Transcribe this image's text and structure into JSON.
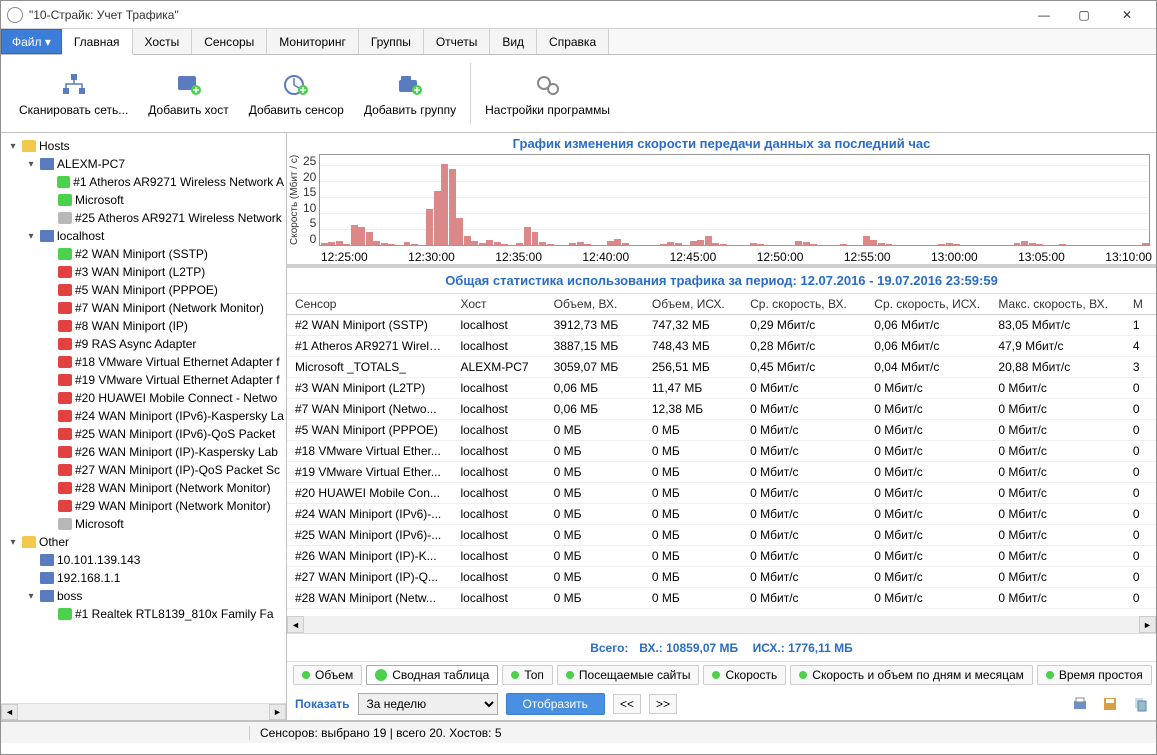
{
  "window": {
    "title": "\"10-Страйк: Учет Трафика\""
  },
  "menu": {
    "file": "Файл ▾",
    "tabs": [
      "Главная",
      "Хосты",
      "Сенсоры",
      "Мониторинг",
      "Группы",
      "Отчеты",
      "Вид",
      "Справка"
    ],
    "active": 0
  },
  "ribbon": {
    "scan": "Сканировать сеть...",
    "add_host": "Добавить хост",
    "add_sensor": "Добавить сенсор",
    "add_group": "Добавить группу",
    "settings": "Настройки программы"
  },
  "tree": [
    {
      "d": 0,
      "exp": "▾",
      "ic": "folder",
      "t": "Hosts"
    },
    {
      "d": 1,
      "exp": "▾",
      "ic": "pc",
      "t": "ALEXM-PC7"
    },
    {
      "d": 2,
      "exp": "",
      "ic": "green",
      "t": "#1 Atheros AR9271 Wireless Network A"
    },
    {
      "d": 2,
      "exp": "",
      "ic": "green",
      "t": "Microsoft"
    },
    {
      "d": 2,
      "exp": "",
      "ic": "gray",
      "t": "#25 Atheros AR9271 Wireless Network"
    },
    {
      "d": 1,
      "exp": "▾",
      "ic": "pc",
      "t": "localhost"
    },
    {
      "d": 2,
      "exp": "",
      "ic": "green",
      "t": "#2 WAN Miniport (SSTP)"
    },
    {
      "d": 2,
      "exp": "",
      "ic": "red",
      "t": "#3 WAN Miniport (L2TP)"
    },
    {
      "d": 2,
      "exp": "",
      "ic": "red",
      "t": "#5 WAN Miniport (PPPOE)"
    },
    {
      "d": 2,
      "exp": "",
      "ic": "red",
      "t": "#7 WAN Miniport (Network Monitor)"
    },
    {
      "d": 2,
      "exp": "",
      "ic": "red",
      "t": "#8 WAN Miniport (IP)"
    },
    {
      "d": 2,
      "exp": "",
      "ic": "red",
      "t": "#9 RAS Async Adapter"
    },
    {
      "d": 2,
      "exp": "",
      "ic": "red",
      "t": "#18 VMware Virtual Ethernet Adapter f"
    },
    {
      "d": 2,
      "exp": "",
      "ic": "red",
      "t": "#19 VMware Virtual Ethernet Adapter f"
    },
    {
      "d": 2,
      "exp": "",
      "ic": "red",
      "t": "#20 HUAWEI Mobile Connect - Netwo"
    },
    {
      "d": 2,
      "exp": "",
      "ic": "red",
      "t": "#24 WAN Miniport (IPv6)-Kaspersky La"
    },
    {
      "d": 2,
      "exp": "",
      "ic": "red",
      "t": "#25 WAN Miniport (IPv6)-QoS Packet"
    },
    {
      "d": 2,
      "exp": "",
      "ic": "red",
      "t": "#26 WAN Miniport (IP)-Kaspersky Lab"
    },
    {
      "d": 2,
      "exp": "",
      "ic": "red",
      "t": "#27 WAN Miniport (IP)-QoS Packet Sc"
    },
    {
      "d": 2,
      "exp": "",
      "ic": "red",
      "t": "#28 WAN Miniport (Network Monitor)"
    },
    {
      "d": 2,
      "exp": "",
      "ic": "red",
      "t": "#29 WAN Miniport (Network Monitor)"
    },
    {
      "d": 2,
      "exp": "",
      "ic": "gray",
      "t": "Microsoft"
    },
    {
      "d": 0,
      "exp": "▾",
      "ic": "folder",
      "t": "Other"
    },
    {
      "d": 1,
      "exp": "",
      "ic": "pc",
      "t": "10.101.139.143"
    },
    {
      "d": 1,
      "exp": "",
      "ic": "pc",
      "t": "192.168.1.1"
    },
    {
      "d": 1,
      "exp": "▾",
      "ic": "pc",
      "t": "boss"
    },
    {
      "d": 2,
      "exp": "",
      "ic": "green",
      "t": "#1 Realtek RTL8139_810x Family Fa"
    }
  ],
  "chart": {
    "title": "График изменения скорости передачи данных за последний час",
    "ylabel": "Скорость (Мбит / с)",
    "yticks": [
      "25",
      "20",
      "15",
      "10",
      "5",
      "0"
    ],
    "xticks": [
      "12:25:00",
      "12:30:00",
      "12:35:00",
      "12:40:00",
      "12:45:00",
      "12:50:00",
      "12:55:00",
      "13:00:00",
      "13:05:00",
      "13:10:00"
    ]
  },
  "chart_data": {
    "type": "line",
    "ylabel": "Скорость (Мбит / с)",
    "ylim": [
      0,
      25
    ],
    "x": [
      "12:25:00",
      "12:30:00",
      "12:35:00",
      "12:40:00",
      "12:45:00",
      "12:50:00",
      "12:55:00",
      "13:00:00",
      "13:05:00",
      "13:10:00"
    ],
    "values_approx_pct_of_max": [
      2,
      3,
      5,
      1,
      22,
      20,
      15,
      4,
      2,
      1,
      0,
      3,
      1,
      0,
      40,
      60,
      90,
      85,
      30,
      10,
      4,
      2,
      6,
      3,
      1,
      0,
      2,
      20,
      14,
      3,
      1,
      0,
      0,
      2,
      3,
      1,
      0,
      0,
      5,
      7,
      2,
      0,
      0,
      0,
      0,
      1,
      3,
      2,
      0,
      4,
      6,
      10,
      2,
      1,
      0,
      0,
      0,
      2,
      1,
      0,
      0,
      0,
      0,
      5,
      3,
      1,
      0,
      0,
      0,
      1,
      0,
      0,
      10,
      6,
      2,
      1,
      0,
      0,
      0,
      0,
      0,
      0,
      1,
      2,
      1,
      0,
      0,
      0,
      0,
      0,
      0,
      0,
      2,
      4,
      2,
      1,
      0,
      0,
      1,
      0,
      0,
      0,
      0,
      0,
      0,
      0,
      0,
      0,
      0,
      2
    ]
  },
  "stats": {
    "title": "Общая статистика использования трафика за период: 12.07.2016 - 19.07.2016 23:59:59",
    "cols": [
      "Сенсор",
      "Хост",
      "Объем, ВХ.",
      "Объем, ИСХ.",
      "Ср. скорость, ВХ.",
      "Ср. скорость, ИСХ.",
      "Макс. скорость, ВХ.",
      "М"
    ],
    "rows": [
      [
        "#2 WAN Miniport (SSTP)",
        "localhost",
        "3912,73 МБ",
        "747,32 МБ",
        "0,29 Мбит/с",
        "0,06 Мбит/с",
        "83,05 Мбит/с",
        "1"
      ],
      [
        "#1 Atheros AR9271 Wirele...",
        "localhost",
        "3887,15 МБ",
        "748,43 МБ",
        "0,28 Мбит/с",
        "0,06 Мбит/с",
        "47,9 Мбит/с",
        "4"
      ],
      [
        "Microsoft _TOTALS_",
        "ALEXM-PC7",
        "3059,07 МБ",
        "256,51 МБ",
        "0,45 Мбит/с",
        "0,04 Мбит/с",
        "20,88 Мбит/с",
        "3"
      ],
      [
        "#3 WAN Miniport (L2TP)",
        "localhost",
        "0,06 МБ",
        "11,47 МБ",
        "0 Мбит/с",
        "0 Мбит/с",
        "0 Мбит/с",
        "0"
      ],
      [
        "#7 WAN Miniport (Netwo...",
        "localhost",
        "0,06 МБ",
        "12,38 МБ",
        "0 Мбит/с",
        "0 Мбит/с",
        "0 Мбит/с",
        "0"
      ],
      [
        "#5 WAN Miniport (PPPOE)",
        "localhost",
        "0 МБ",
        "0 МБ",
        "0 Мбит/с",
        "0 Мбит/с",
        "0 Мбит/с",
        "0"
      ],
      [
        "#18 VMware Virtual Ether...",
        "localhost",
        "0 МБ",
        "0 МБ",
        "0 Мбит/с",
        "0 Мбит/с",
        "0 Мбит/с",
        "0"
      ],
      [
        "#19 VMware Virtual Ether...",
        "localhost",
        "0 МБ",
        "0 МБ",
        "0 Мбит/с",
        "0 Мбит/с",
        "0 Мбит/с",
        "0"
      ],
      [
        "#20 HUAWEI Mobile Con...",
        "localhost",
        "0 МБ",
        "0 МБ",
        "0 Мбит/с",
        "0 Мбит/с",
        "0 Мбит/с",
        "0"
      ],
      [
        "#24 WAN Miniport (IPv6)-...",
        "localhost",
        "0 МБ",
        "0 МБ",
        "0 Мбит/с",
        "0 Мбит/с",
        "0 Мбит/с",
        "0"
      ],
      [
        "#25 WAN Miniport (IPv6)-...",
        "localhost",
        "0 МБ",
        "0 МБ",
        "0 Мбит/с",
        "0 Мбит/с",
        "0 Мбит/с",
        "0"
      ],
      [
        "#26 WAN Miniport (IP)-K...",
        "localhost",
        "0 МБ",
        "0 МБ",
        "0 Мбит/с",
        "0 Мбит/с",
        "0 Мбит/с",
        "0"
      ],
      [
        "#27 WAN Miniport (IP)-Q...",
        "localhost",
        "0 МБ",
        "0 МБ",
        "0 Мбит/с",
        "0 Мбит/с",
        "0 Мбит/с",
        "0"
      ],
      [
        "#28 WAN Miniport (Netw...",
        "localhost",
        "0 МБ",
        "0 МБ",
        "0 Мбит/с",
        "0 Мбит/с",
        "0 Мбит/с",
        "0"
      ]
    ]
  },
  "totals": {
    "label": "Всего:",
    "in": "ВХ.: 10859,07 МБ",
    "out": "ИСХ.: 1776,11 МБ"
  },
  "bottom_tabs": [
    "Объем",
    "Сводная таблица",
    "Топ",
    "Посещаемые сайты",
    "Скорость",
    "Скорость и объем по дням и месяцам",
    "Время простоя"
  ],
  "bottom_tabs_active": 1,
  "controls": {
    "show_label": "Показать",
    "period": "За неделю",
    "display_btn": "Отобразить",
    "prev": "<<",
    "next": ">>"
  },
  "status": "Сенсоров: выбрано 19 | всего 20. Хостов: 5"
}
